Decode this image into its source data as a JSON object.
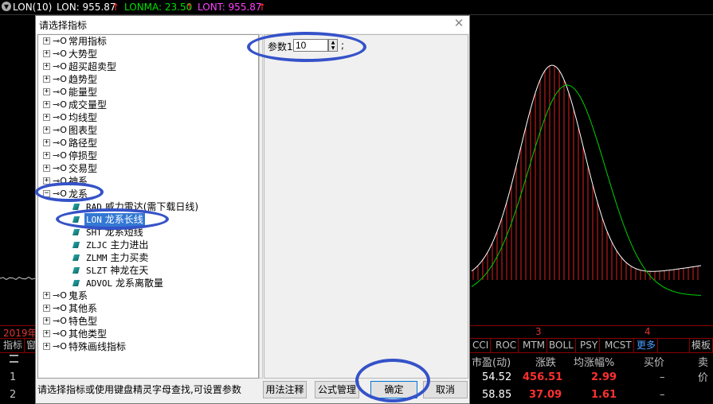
{
  "top_bar": {
    "indicator_name": "LON(10)",
    "lon": "LON: 955.87",
    "lonma": "LONMA: 23.50",
    "lont": "LONT: 955.87",
    "arrow": "↑",
    "colors": {
      "lon": "#ffffff",
      "lonma": "#00e000",
      "lont": "#ff40ff",
      "arrow": "#ff3030"
    }
  },
  "chart_axis": {
    "year_label": "2019年",
    "tick_3": "3",
    "tick_4": "4"
  },
  "tabs": {
    "left": [
      "指标",
      "窗"
    ],
    "right": [
      "CCI",
      "ROC",
      "MTM",
      "BOLL",
      "PSY",
      "MCST"
    ],
    "more": "更多",
    "template": "模板"
  },
  "table": {
    "row_icon": "menu-icon",
    "headers": {
      "pe": "市盈(动)",
      "change": "涨跌",
      "avg_change": "均涨幅%",
      "bid": "买价",
      "ask": "卖价"
    },
    "rows": [
      {
        "index": "1",
        "pe": "54.52",
        "change": "456.51",
        "avg_change": "2.99",
        "bid": "–"
      },
      {
        "index": "2",
        "pe": "58.85",
        "change": "37.09",
        "avg_change": "1.61",
        "bid": "–"
      }
    ]
  },
  "dialog": {
    "title": "请选择指标",
    "close_icon": "close-icon",
    "tree": {
      "groups": [
        "常用指标",
        "大势型",
        "超买超卖型",
        "趋势型",
        "能量型",
        "成交量型",
        "均线型",
        "图表型",
        "路径型",
        "停损型",
        "交易型",
        "神系"
      ],
      "expanded_group": "龙系",
      "leaves": [
        {
          "code": "RAD",
          "name": "威力雷达(需下载日线)"
        },
        {
          "code": "LON",
          "name": "龙系长线"
        },
        {
          "code": "SHT",
          "name": "龙系短线"
        },
        {
          "code": "ZLJC",
          "name": "主力进出"
        },
        {
          "code": "ZLMM",
          "name": "主力买卖"
        },
        {
          "code": "SLZT",
          "name": "神龙在天"
        },
        {
          "code": "ADVOL",
          "name": "龙系离散量"
        }
      ],
      "selected_leaf": "LON",
      "groups_after": [
        "鬼系",
        "其他系",
        "特色型",
        "其他类型",
        "特殊画线指标"
      ]
    },
    "param": {
      "label": "参数1:",
      "value": "10",
      "suffix": ";"
    },
    "status_text": "请选择指标或使用键盘精灵字母查找,可设置参数",
    "buttons": {
      "usage_notes": "用法注释",
      "formula_manage": "公式管理",
      "ok": "确定",
      "cancel": "取消"
    }
  },
  "annotation_color": "#3552c8"
}
